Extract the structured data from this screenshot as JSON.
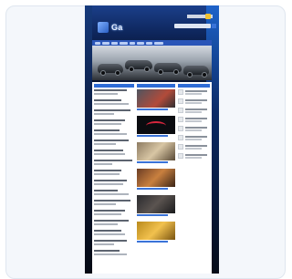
{
  "site": {
    "logo": "Ga",
    "nav_items": [
      "",
      "",
      "",
      "",
      "",
      "",
      "",
      "",
      "",
      ""
    ]
  },
  "colors": {
    "accent": "#2e6cd6",
    "background": "#0a1530",
    "card": "#f4f7fb"
  },
  "icons": [
    "logo-mark-icon",
    "search-icon"
  ]
}
